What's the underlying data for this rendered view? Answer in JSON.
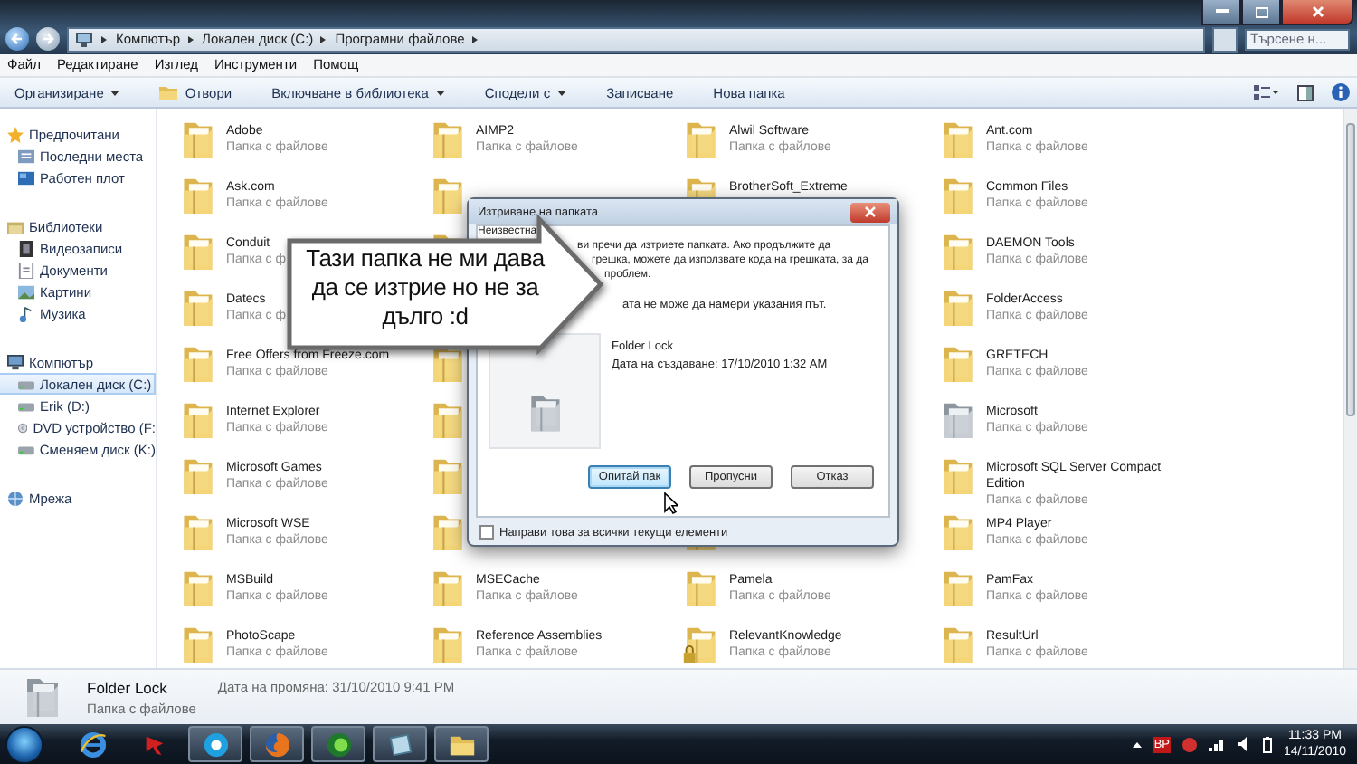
{
  "address": {
    "breadcrumbs": [
      "Компютър",
      "Локален диск (C:)",
      "Програмни файлове"
    ],
    "search": {
      "placeholder": "Търсене н..."
    }
  },
  "menu": [
    "Файл",
    "Редактиране",
    "Изглед",
    "Инструменти",
    "Помощ"
  ],
  "toolbar": [
    {
      "label": "Организиране",
      "dropdown": true,
      "icon": false
    },
    {
      "label": "Отвори",
      "dropdown": false,
      "icon": true
    },
    {
      "label": "Включване в библиотека",
      "dropdown": true,
      "icon": false
    },
    {
      "label": "Сподели с",
      "dropdown": true,
      "icon": false
    },
    {
      "label": "Записване",
      "dropdown": false,
      "icon": false
    },
    {
      "label": "Нова папка",
      "dropdown": false,
      "icon": false
    }
  ],
  "sidebar": {
    "groups": [
      {
        "label": "Предпочитани",
        "kind": "star",
        "selected": false,
        "children": [
          {
            "label": "Последни места",
            "kind": "recent",
            "selected": false
          },
          {
            "label": "Работен плот",
            "kind": "desktop",
            "selected": false
          }
        ]
      },
      {
        "label": "Библиотеки",
        "kind": "library",
        "selected": false,
        "children": [
          {
            "label": "Видеозаписи",
            "kind": "video",
            "selected": false
          },
          {
            "label": "Документи",
            "kind": "document",
            "selected": false
          },
          {
            "label": "Картини",
            "kind": "pictures",
            "selected": false
          },
          {
            "label": "Музика",
            "kind": "music",
            "selected": false
          }
        ]
      },
      {
        "label": "Компютър",
        "kind": "computer",
        "selected": false,
        "children": [
          {
            "label": "Локален диск (C:)",
            "kind": "drive",
            "selected": true
          },
          {
            "label": "Erik (D:)",
            "kind": "drive",
            "selected": false
          },
          {
            "label": "DVD устройство (F:",
            "kind": "disc",
            "selected": false
          },
          {
            "label": "Сменяем диск (K:)",
            "kind": "drive",
            "selected": false
          }
        ]
      },
      {
        "label": "Мрежа",
        "kind": "network",
        "selected": false
      }
    ]
  },
  "files": [
    {
      "kind": "folder",
      "name": "Adobe",
      "type": "Папка с файлове"
    },
    {
      "kind": "folder",
      "name": "AIMP2",
      "type": "Папка с файлове"
    },
    {
      "kind": "folder",
      "name": "Alwil Software",
      "type": "Папка с файлове"
    },
    {
      "kind": "folder",
      "name": "Ant.com",
      "type": "Папка с файлове"
    },
    {
      "kind": "folder",
      "name": "Ask.com",
      "type": "Папка с файлове"
    },
    {
      "kind": "covered"
    },
    {
      "kind": "folder",
      "name": "BrotherSoft_Extreme"
    },
    {
      "kind": "folder",
      "name": "Common Files",
      "type": "Папка с файлове"
    },
    {
      "kind": "folder",
      "name": "Conduit",
      "type": "Папка с ф"
    },
    {
      "kind": "covered"
    },
    {
      "kind": "covered"
    },
    {
      "kind": "folder",
      "name": "DAEMON Tools",
      "type": "Папка с файлове"
    },
    {
      "kind": "folder",
      "name": "Datecs",
      "type": "Папка с ф"
    },
    {
      "kind": "covered"
    },
    {
      "kind": "covered"
    },
    {
      "kind": "folder",
      "name": "FolderAccess",
      "type": "Папка с файлове"
    },
    {
      "kind": "folder",
      "name": "Free Offers from Freeze.com",
      "type": "Папка с файлове"
    },
    {
      "kind": "covered"
    },
    {
      "kind": "covered"
    },
    {
      "kind": "folder",
      "name": "GRETECH",
      "type": "Папка с файлове"
    },
    {
      "kind": "folder",
      "name": "Internet Explorer",
      "type": "Папка с файлове"
    },
    {
      "kind": "covered"
    },
    {
      "kind": "covered"
    },
    {
      "kind": "grey-folder",
      "name": "Microsoft",
      "type": "Папка с файлове"
    },
    {
      "kind": "folder",
      "name": "Microsoft Games",
      "type": "Папка с файлове"
    },
    {
      "kind": "covered"
    },
    {
      "kind": "covered"
    },
    {
      "kind": "folder",
      "name": "Microsoft SQL Server Compact Edition",
      "type": "Папка с файлове"
    },
    {
      "kind": "folder",
      "name": "Microsoft WSE",
      "type": "Папка с файлове"
    },
    {
      "kind": "covered"
    },
    {
      "kind": "covered"
    },
    {
      "kind": "folder",
      "name": "MP4 Player",
      "type": "Папка с файлове"
    },
    {
      "kind": "folder",
      "name": "MSBuild",
      "type": "Папка с файлове"
    },
    {
      "kind": "folder",
      "name": "MSECache",
      "type": "Папка с файлове"
    },
    {
      "kind": "folder",
      "name": "Pamela",
      "type": "Папка с файлове"
    },
    {
      "kind": "folder",
      "name": "PamFax",
      "type": "Папка с файлове"
    },
    {
      "kind": "folder",
      "name": "PhotoScape",
      "type": "Папка с файлове"
    },
    {
      "kind": "folder",
      "name": "Reference Assemblies",
      "type": "Папка с файлове"
    },
    {
      "kind": "locked-folder",
      "name": "RelevantKnowledge",
      "type": "Папка с файлове"
    },
    {
      "kind": "folder",
      "name": "ResultUrl",
      "type": "Папка с файлове"
    }
  ],
  "dialog": {
    "title": "Изтриване на папката",
    "lead": "Неизвестна",
    "message_lines": [
      "ви пречи да изтриете папката. Ако продължите да",
      "грешка, можете да използвате кода на грешката, за да",
      "проблем."
    ],
    "error": "ата не може да намери указания път.",
    "item": {
      "name": "Folder Lock",
      "date": "Дата на създаване: 17/10/2010 1:32 AM"
    },
    "buttons": [
      {
        "label": "Опитай пак",
        "selected": true
      },
      {
        "label": "Пропусни",
        "selected": false
      },
      {
        "label": "Отказ",
        "selected": false
      }
    ],
    "checkbox": {
      "label": "Направи това за всички текущи елементи",
      "checked": false
    }
  },
  "callout": {
    "lines": [
      "Тази папка не ми дава",
      "да се изтрие но не за",
      "дълго :d"
    ]
  },
  "details": {
    "name": "Folder Lock",
    "type": "Папка с файлове",
    "modified": "Дата на промяна: 31/10/2010 9:41 PM"
  },
  "taskbar": {
    "apps": [
      {
        "kind": "browser",
        "selected": false
      },
      {
        "kind": "app",
        "selected": false
      },
      {
        "kind": "chat",
        "selected": true
      },
      {
        "kind": "firefox",
        "selected": true
      },
      {
        "kind": "media",
        "selected": true
      },
      {
        "kind": "notes",
        "selected": true
      },
      {
        "kind": "explorer",
        "selected": true
      }
    ],
    "language": "BP",
    "time": "11:33 PM",
    "date": "14/11/2010"
  }
}
